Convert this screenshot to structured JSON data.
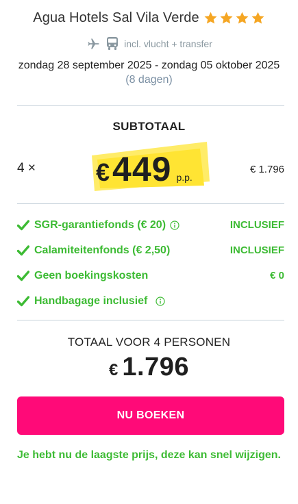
{
  "hotel": {
    "name": "Agua Hotels Sal Vila Verde",
    "star_count": 4,
    "star_color": "#f5a623"
  },
  "transport": {
    "icons": [
      "airplane-icon",
      "bus-icon"
    ],
    "label": "incl. vlucht + transfer"
  },
  "trip": {
    "dates": "zondag 28 september 2025 - zondag 05 oktober 2025",
    "duration": "(8 dagen)"
  },
  "subtotal": {
    "label": "SUBTOTAAL",
    "quantity": "4 ×",
    "currency": "€",
    "price": "449",
    "per_person": "p.p.",
    "line_total": "€ 1.796",
    "highlight_color": "#ffe94d"
  },
  "features": [
    {
      "label": "SGR-garantiefonds  (€ 20)",
      "info": true,
      "value": "INCLUSIEF"
    },
    {
      "label": "Calamiteitenfonds  (€ 2,50)",
      "info": false,
      "value": "INCLUSIEF"
    },
    {
      "label": "Geen boekingskosten",
      "info": false,
      "value": "€ 0"
    },
    {
      "label": "Handbagage inclusief",
      "info": true,
      "value": ""
    }
  ],
  "total": {
    "label": "TOTAAL VOOR 4 PERSONEN",
    "currency": "€",
    "amount": "1.796"
  },
  "cta": {
    "label": "NU BOEKEN",
    "color": "#ff0a78"
  },
  "note": "Je hebt nu de laagste prijs, deze kan snel wijzigen.",
  "colors": {
    "accent_green": "#3dbb34",
    "muted_blue": "#7a8fa3"
  }
}
